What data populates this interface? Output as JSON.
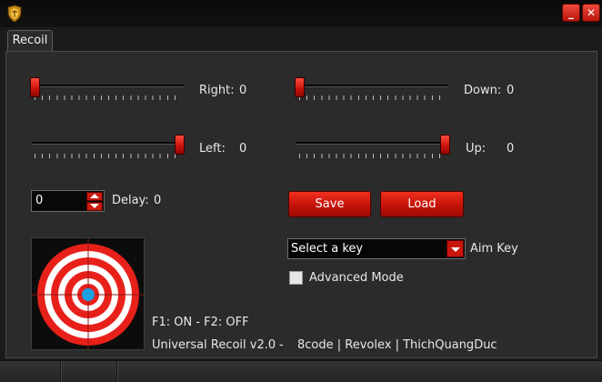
{
  "window": {
    "minimize_glyph": "_",
    "close_glyph": "✕"
  },
  "tabs": [
    {
      "label": "Recoil",
      "active": true
    }
  ],
  "sliders": {
    "right": {
      "label": "Right:",
      "value": "0",
      "level": 0.0
    },
    "down": {
      "label": "Down:",
      "value": "0",
      "level": 0.0
    },
    "left": {
      "label": "Left:",
      "value": "0",
      "level": 1.0
    },
    "up": {
      "label": "Up:",
      "value": "0",
      "level": 1.0
    }
  },
  "delay": {
    "label": "Delay:",
    "value": "0",
    "input_value": "0"
  },
  "buttons": {
    "save": "Save",
    "load": "Load"
  },
  "aim_key": {
    "selected": "Select a key",
    "label": "Aim Key"
  },
  "advanced_mode": {
    "label": "Advanced Mode",
    "checked": false
  },
  "hotkeys": "F1: ON - F2: OFF",
  "credits": {
    "version": "Universal Recoil v2.0",
    "separator": "-",
    "authors": "8code | Revolex | ThichQuangDuc"
  },
  "colors": {
    "accent": "#d0180e",
    "target_ring": "#e8201a",
    "target_center": "#1e9fe0",
    "background": "#2b2b2b"
  },
  "icons": {
    "logo": "shield-crest-icon",
    "target": "crosshair-target-icon"
  }
}
